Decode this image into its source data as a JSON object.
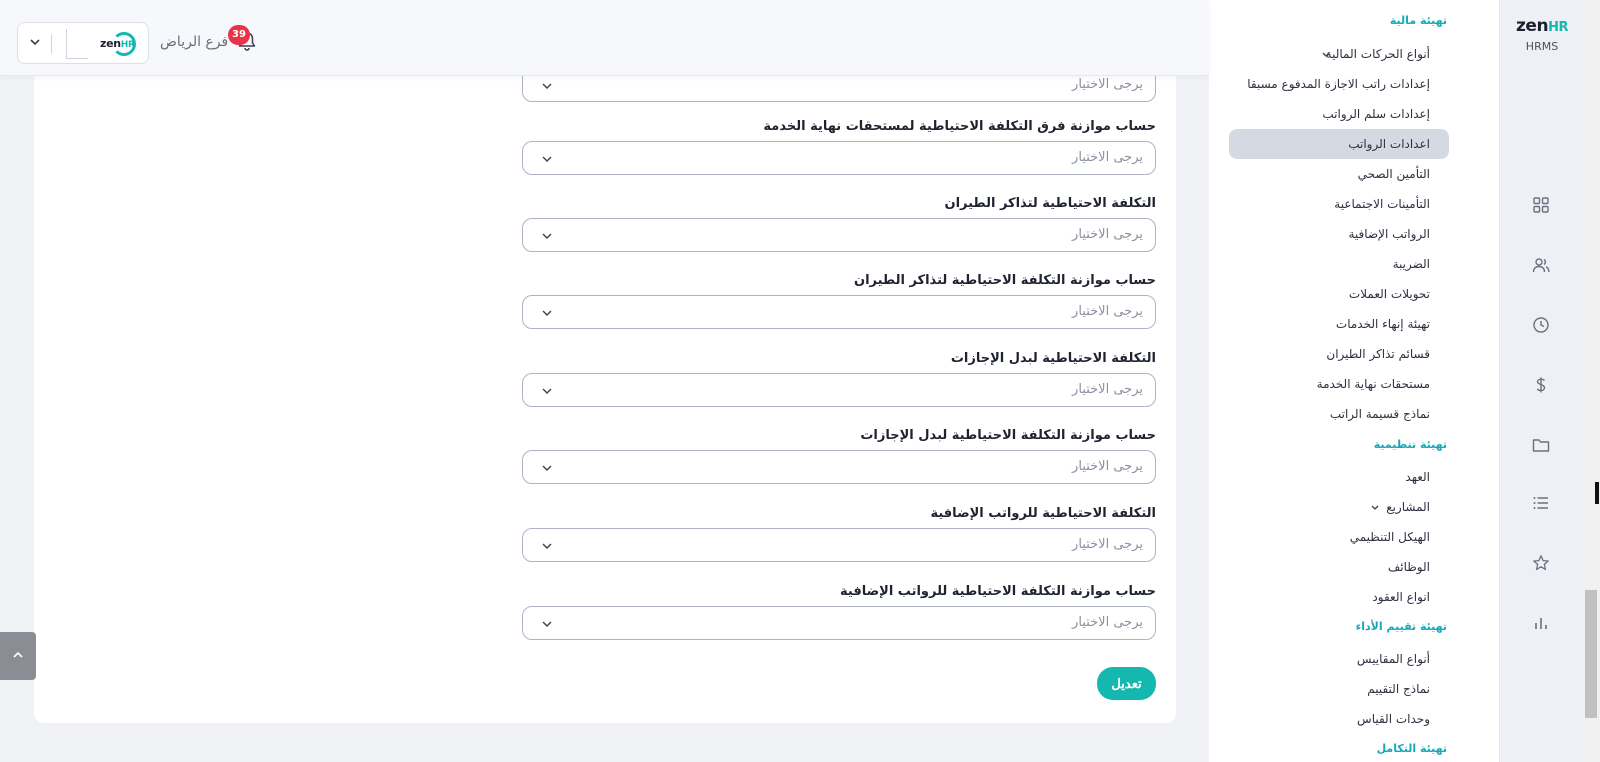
{
  "header": {
    "branch_name": "فرع الرياض",
    "notification_count": "39",
    "logo_text": "zen",
    "logo_accent": "HR"
  },
  "form": {
    "fields": [
      {
        "label": "",
        "placeholder": "يرجى الاختيار"
      },
      {
        "label": "حساب موازنة فرق التكلفة الاحتياطية لمستحقات نهاية الخدمة",
        "placeholder": "يرجى الاختيار"
      },
      {
        "label": "التكلفة الاحتياطية لتذاكر الطيران",
        "placeholder": "يرجى الاختيار"
      },
      {
        "label": "حساب موازنة التكلفة الاحتياطية لتذاكر الطيران",
        "placeholder": "يرجى الاختيار"
      },
      {
        "label": "التكلفة الاحتياطية لبدل الإجازات",
        "placeholder": "يرجى الاختيار"
      },
      {
        "label": "حساب موازنة التكلفة الاحتياطية لبدل الإجازات",
        "placeholder": "يرجى الاختيار"
      },
      {
        "label": "التكلفة الاحتياطية للرواتب الإضافية",
        "placeholder": "يرجى الاختيار"
      },
      {
        "label": "حساب موازنة التكلفة الاحتياطية للرواتب الإضافية",
        "placeholder": "يرجى الاختيار"
      }
    ],
    "submit_label": "تعديل"
  },
  "submenu": {
    "head_financial": "تهيئة مالية",
    "items_financial": [
      "أنواع الحركات المالية",
      "إعدادات راتب الاجازة المدفوع مسبقا",
      "إعدادات سلم الرواتب",
      "اعدادات الرواتب",
      "التأمين الصحي",
      "التأمينات الاجتماعية",
      "الرواتب الإضافية",
      "الضريبة",
      "تحويلات العملات",
      "تهيئة إنهاء الخدمات",
      "قسائم تذاكر الطيران",
      "مستحقات نهاية الخدمة",
      "نماذج قسيمة الراتب"
    ],
    "head_org": "تهيئة تنظيمية",
    "items_org": [
      "العهد",
      "المشاريع",
      "الهيكل التنظيمي",
      "الوظائف",
      "انواع العقود"
    ],
    "head_perf": "تهيئة تقييم الأداء",
    "items_perf": [
      "أنواع المقاييس",
      "نماذج التقييم",
      "وحدات القياس"
    ],
    "head_integration": "تهيئة التكامل"
  },
  "rail": {
    "logo_text": "zen",
    "logo_accent": "HR",
    "product": "HRMS",
    "icons": [
      "dashboard-icon",
      "users-icon",
      "clock-icon",
      "dollar-icon",
      "folder-icon",
      "list-icon",
      "star-icon",
      "bar-chart-icon"
    ]
  },
  "colors": {
    "accent": "#14b8ae",
    "badge": "#e8344a",
    "active_item": "#d5d9e2",
    "section_head": "#16a8b8"
  }
}
